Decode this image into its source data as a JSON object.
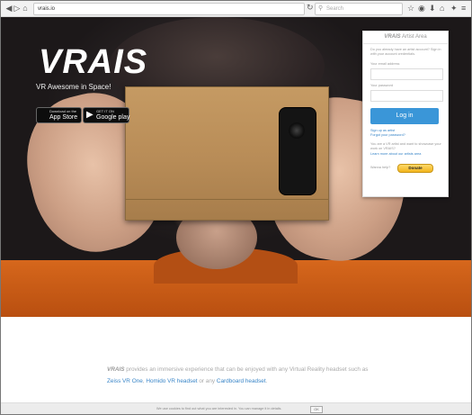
{
  "browser": {
    "url": "vrais.io",
    "search_placeholder": "Search"
  },
  "hero": {
    "brand": "VRAIS",
    "tagline": "VR Awesome in Space!",
    "app_store": {
      "small": "Download on the",
      "big": "App Store"
    },
    "google_play": {
      "small": "GET IT ON",
      "big": "Google play"
    }
  },
  "panel": {
    "title_brand": "VRAIS",
    "title_rest": "Artist Area",
    "intro": "Do you already have an artist account? Sign in with your account credentials.",
    "email_label": "Your email address",
    "password_label": "Your password",
    "login_label": "Log in",
    "signup_link": "Sign up as artist",
    "forgot_link": "Forgot your password?",
    "account_note": "You are a VR artist and want to showcase your work on VRAIS?",
    "learn_link": "Learn more about our artists area",
    "donate_prompt": "Wanna help?",
    "donate_label": "Donate"
  },
  "lower": {
    "brand": "VRAIS",
    "text1": " provides an immersive experience that can be enjoyed with any Virtual Reality headset such as ",
    "link1": "Zeiss VR One",
    "sep1": ", ",
    "link2": "Homido VR headset",
    "sep2": " or any ",
    "link3": "Cardboard headset",
    "end": "."
  },
  "cookie": {
    "text": "We use cookies to find out what you are interested in. You can manage it in details.",
    "ok": "OK"
  },
  "colors": {
    "accent": "#3a96d8",
    "link": "#3a86c8",
    "donate": "#f2b51d",
    "shirt": "#d6671c"
  }
}
